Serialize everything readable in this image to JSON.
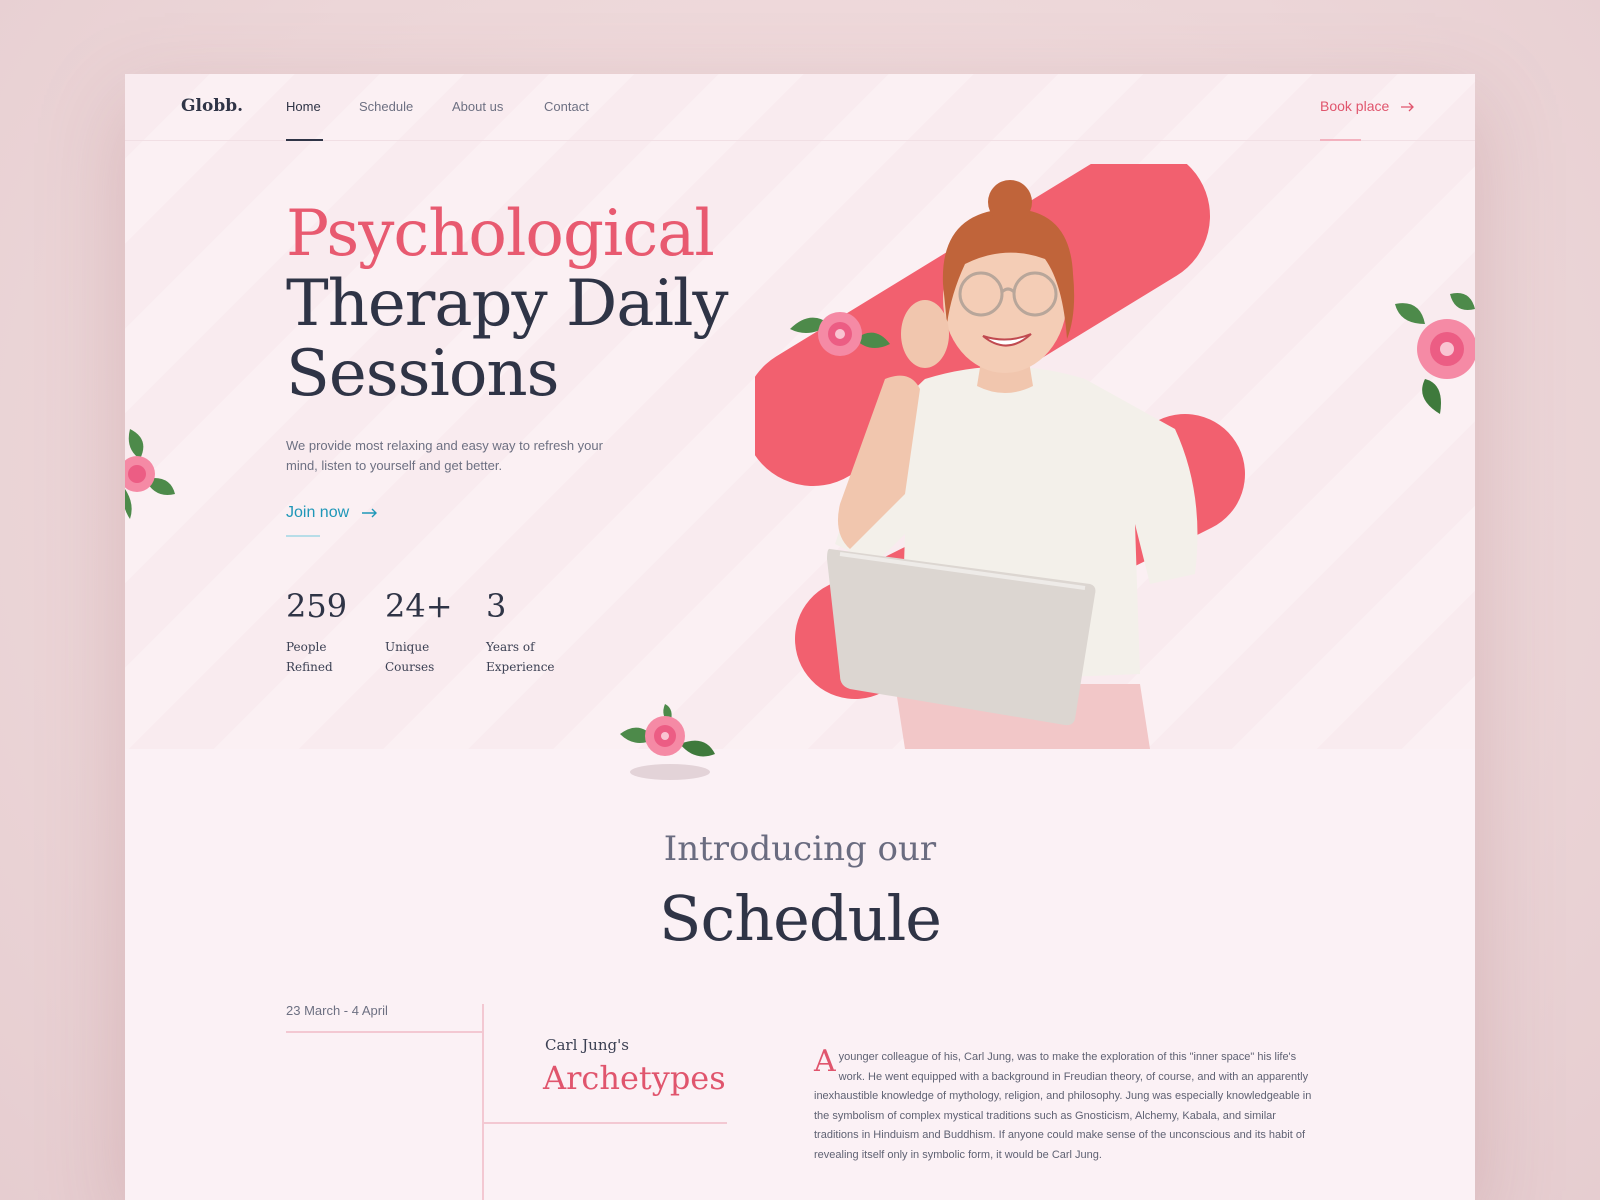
{
  "nav": {
    "logo": "Globb.",
    "links": [
      "Home",
      "Schedule",
      "About us",
      "Contact"
    ],
    "cta": "Book place"
  },
  "hero": {
    "title_line1": "Psychological",
    "title_line2": "Therapy Daily",
    "title_line3": "Sessions",
    "description": "We provide most relaxing and easy way to refresh your mind, listen to yourself and get better.",
    "join_label": "Join now",
    "stats": [
      {
        "value": "259",
        "label": "People\nRefined"
      },
      {
        "value": "24+",
        "label": "Unique\nCourses"
      },
      {
        "value": "3",
        "label": "Years of\nExperience"
      }
    ]
  },
  "schedule": {
    "intro": "Introducing our",
    "title": "Schedule",
    "date_range": "23 March - 4 April",
    "course_subtitle": "Carl Jung's",
    "course_title": "Archetypes",
    "dropcap": "A",
    "paragraph": "younger colleague of his, Carl Jung, was to make the exploration of this \"inner space\" his life's work. He went equipped with a background in Freudian theory, of course, and with an apparently inexhaustible knowledge of mythology, religion, and philosophy. Jung was especially knowledgeable in the symbolism of complex mystical traditions such as Gnosticism, Alchemy, Kabala, and similar traditions in Hinduism and Buddhism. If anyone could make sense of the unconscious and its habit of revealing itself only in symbolic form, it would be Carl Jung."
  },
  "colors": {
    "accent": "#e85a70",
    "navy": "#2f3446",
    "link_blue": "#1f97b8",
    "shape_red": "#f2606f"
  }
}
